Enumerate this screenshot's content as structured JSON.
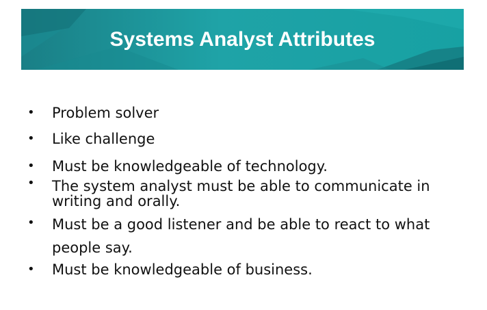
{
  "slide": {
    "title": "Systems Analyst Attributes",
    "colors": {
      "banner_dark": "#1a7f86",
      "banner_light": "#1fa3a7",
      "title_text": "#ffffff",
      "body_text": "#111111"
    },
    "bullets": [
      "Problem solver",
      "Like challenge",
      "Must be knowledgeable of technology.",
      "The system analyst must be able to communicate in writing and orally.",
      "Must be a good listener and be able to react to what people say.",
      "Must be knowledgeable of business."
    ]
  }
}
